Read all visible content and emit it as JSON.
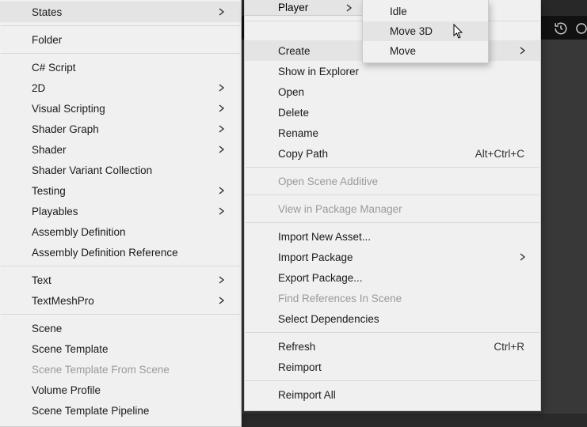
{
  "menu1": {
    "items": [
      {
        "label": "States",
        "chevron": true,
        "highlight": true
      },
      {
        "sep": true
      },
      {
        "label": "Folder"
      },
      {
        "sep": true
      },
      {
        "label": "C# Script"
      },
      {
        "label": "2D",
        "chevron": true
      },
      {
        "label": "Visual Scripting",
        "chevron": true
      },
      {
        "label": "Shader Graph",
        "chevron": true
      },
      {
        "label": "Shader",
        "chevron": true
      },
      {
        "label": "Shader Variant Collection"
      },
      {
        "label": "Testing",
        "chevron": true
      },
      {
        "label": "Playables",
        "chevron": true
      },
      {
        "label": "Assembly Definition"
      },
      {
        "label": "Assembly Definition Reference"
      },
      {
        "sep": true
      },
      {
        "label": "Text",
        "chevron": true
      },
      {
        "label": "TextMeshPro",
        "chevron": true
      },
      {
        "sep": true
      },
      {
        "label": "Scene"
      },
      {
        "label": "Scene Template"
      },
      {
        "label": "Scene Template From Scene",
        "disabled": true
      },
      {
        "label": "Volume Profile"
      },
      {
        "label": "Scene Template Pipeline"
      }
    ]
  },
  "menu2_header": {
    "label": "Player",
    "chevron": true
  },
  "menu2": {
    "items": [
      {
        "spacer": true
      },
      {
        "sep": true
      },
      {
        "spacer": true
      },
      {
        "label": "Create",
        "chevron": true,
        "highlight": true
      },
      {
        "label": "Show in Explorer"
      },
      {
        "label": "Open"
      },
      {
        "label": "Delete"
      },
      {
        "label": "Rename"
      },
      {
        "label": "Copy Path",
        "shortcut": "Alt+Ctrl+C"
      },
      {
        "sep": true
      },
      {
        "label": "Open Scene Additive",
        "disabled": true
      },
      {
        "sep": true
      },
      {
        "label": "View in Package Manager",
        "disabled": true
      },
      {
        "sep": true
      },
      {
        "label": "Import New Asset..."
      },
      {
        "label": "Import Package",
        "chevron": true
      },
      {
        "label": "Export Package..."
      },
      {
        "label": "Find References In Scene",
        "disabled": true
      },
      {
        "label": "Select Dependencies"
      },
      {
        "sep": true
      },
      {
        "label": "Refresh",
        "shortcut": "Ctrl+R"
      },
      {
        "label": "Reimport"
      },
      {
        "sep": true
      },
      {
        "label": "Reimport All"
      }
    ]
  },
  "menu3": {
    "items": [
      {
        "label": "Idle"
      },
      {
        "label": "Move 3D",
        "highlight": true
      },
      {
        "label": "Move"
      }
    ]
  }
}
